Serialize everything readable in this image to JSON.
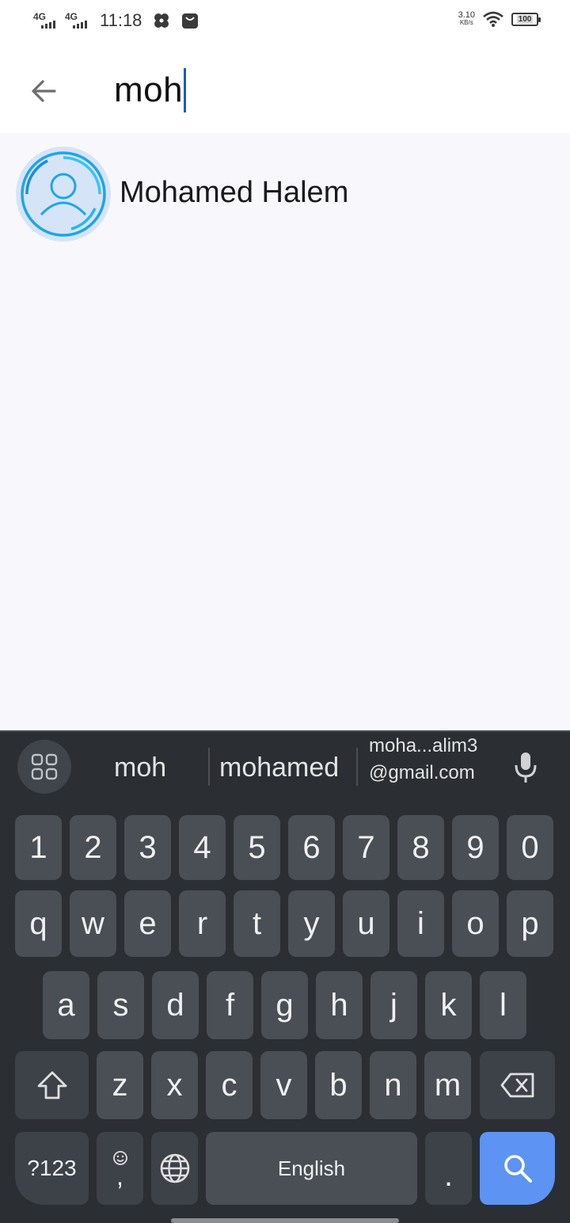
{
  "status_bar": {
    "network1": "4G",
    "network2": "4G",
    "time": "11:18",
    "net_speed_value": "3.10",
    "net_speed_unit": "KB/s",
    "battery": "100"
  },
  "search": {
    "query": "moh"
  },
  "results": [
    {
      "name": "Mohamed Halem"
    }
  ],
  "keyboard": {
    "suggestions": [
      "moh",
      "mohamed"
    ],
    "email_suggestion_line1": "moha...alim3",
    "email_suggestion_line2": "@gmail.com",
    "row_numbers": [
      "1",
      "2",
      "3",
      "4",
      "5",
      "6",
      "7",
      "8",
      "9",
      "0"
    ],
    "row1": [
      "q",
      "w",
      "e",
      "r",
      "t",
      "y",
      "u",
      "i",
      "o",
      "p"
    ],
    "row2": [
      "a",
      "s",
      "d",
      "f",
      "g",
      "h",
      "j",
      "k",
      "l"
    ],
    "row3": [
      "z",
      "x",
      "c",
      "v",
      "b",
      "n",
      "m"
    ],
    "symbols_label": "?123",
    "comma_label": ",",
    "space_label": "English",
    "period_label": "."
  },
  "colors": {
    "caret": "#1a5fb4",
    "enter_key": "#5d93f2",
    "keyboard_bg": "#2b2e33",
    "key_bg": "#4a4e55",
    "avatar_ring": "#1ea6e8"
  },
  "icons": {
    "back": "arrow-left-icon",
    "avatar": "person-avatar-icon",
    "apps": "grid-apps-icon",
    "mic": "microphone-icon",
    "shift": "shift-arrow-icon",
    "backspace": "backspace-icon",
    "emoji": "emoji-icon",
    "globe": "globe-icon",
    "search": "search-icon",
    "wifi": "wifi-icon"
  }
}
